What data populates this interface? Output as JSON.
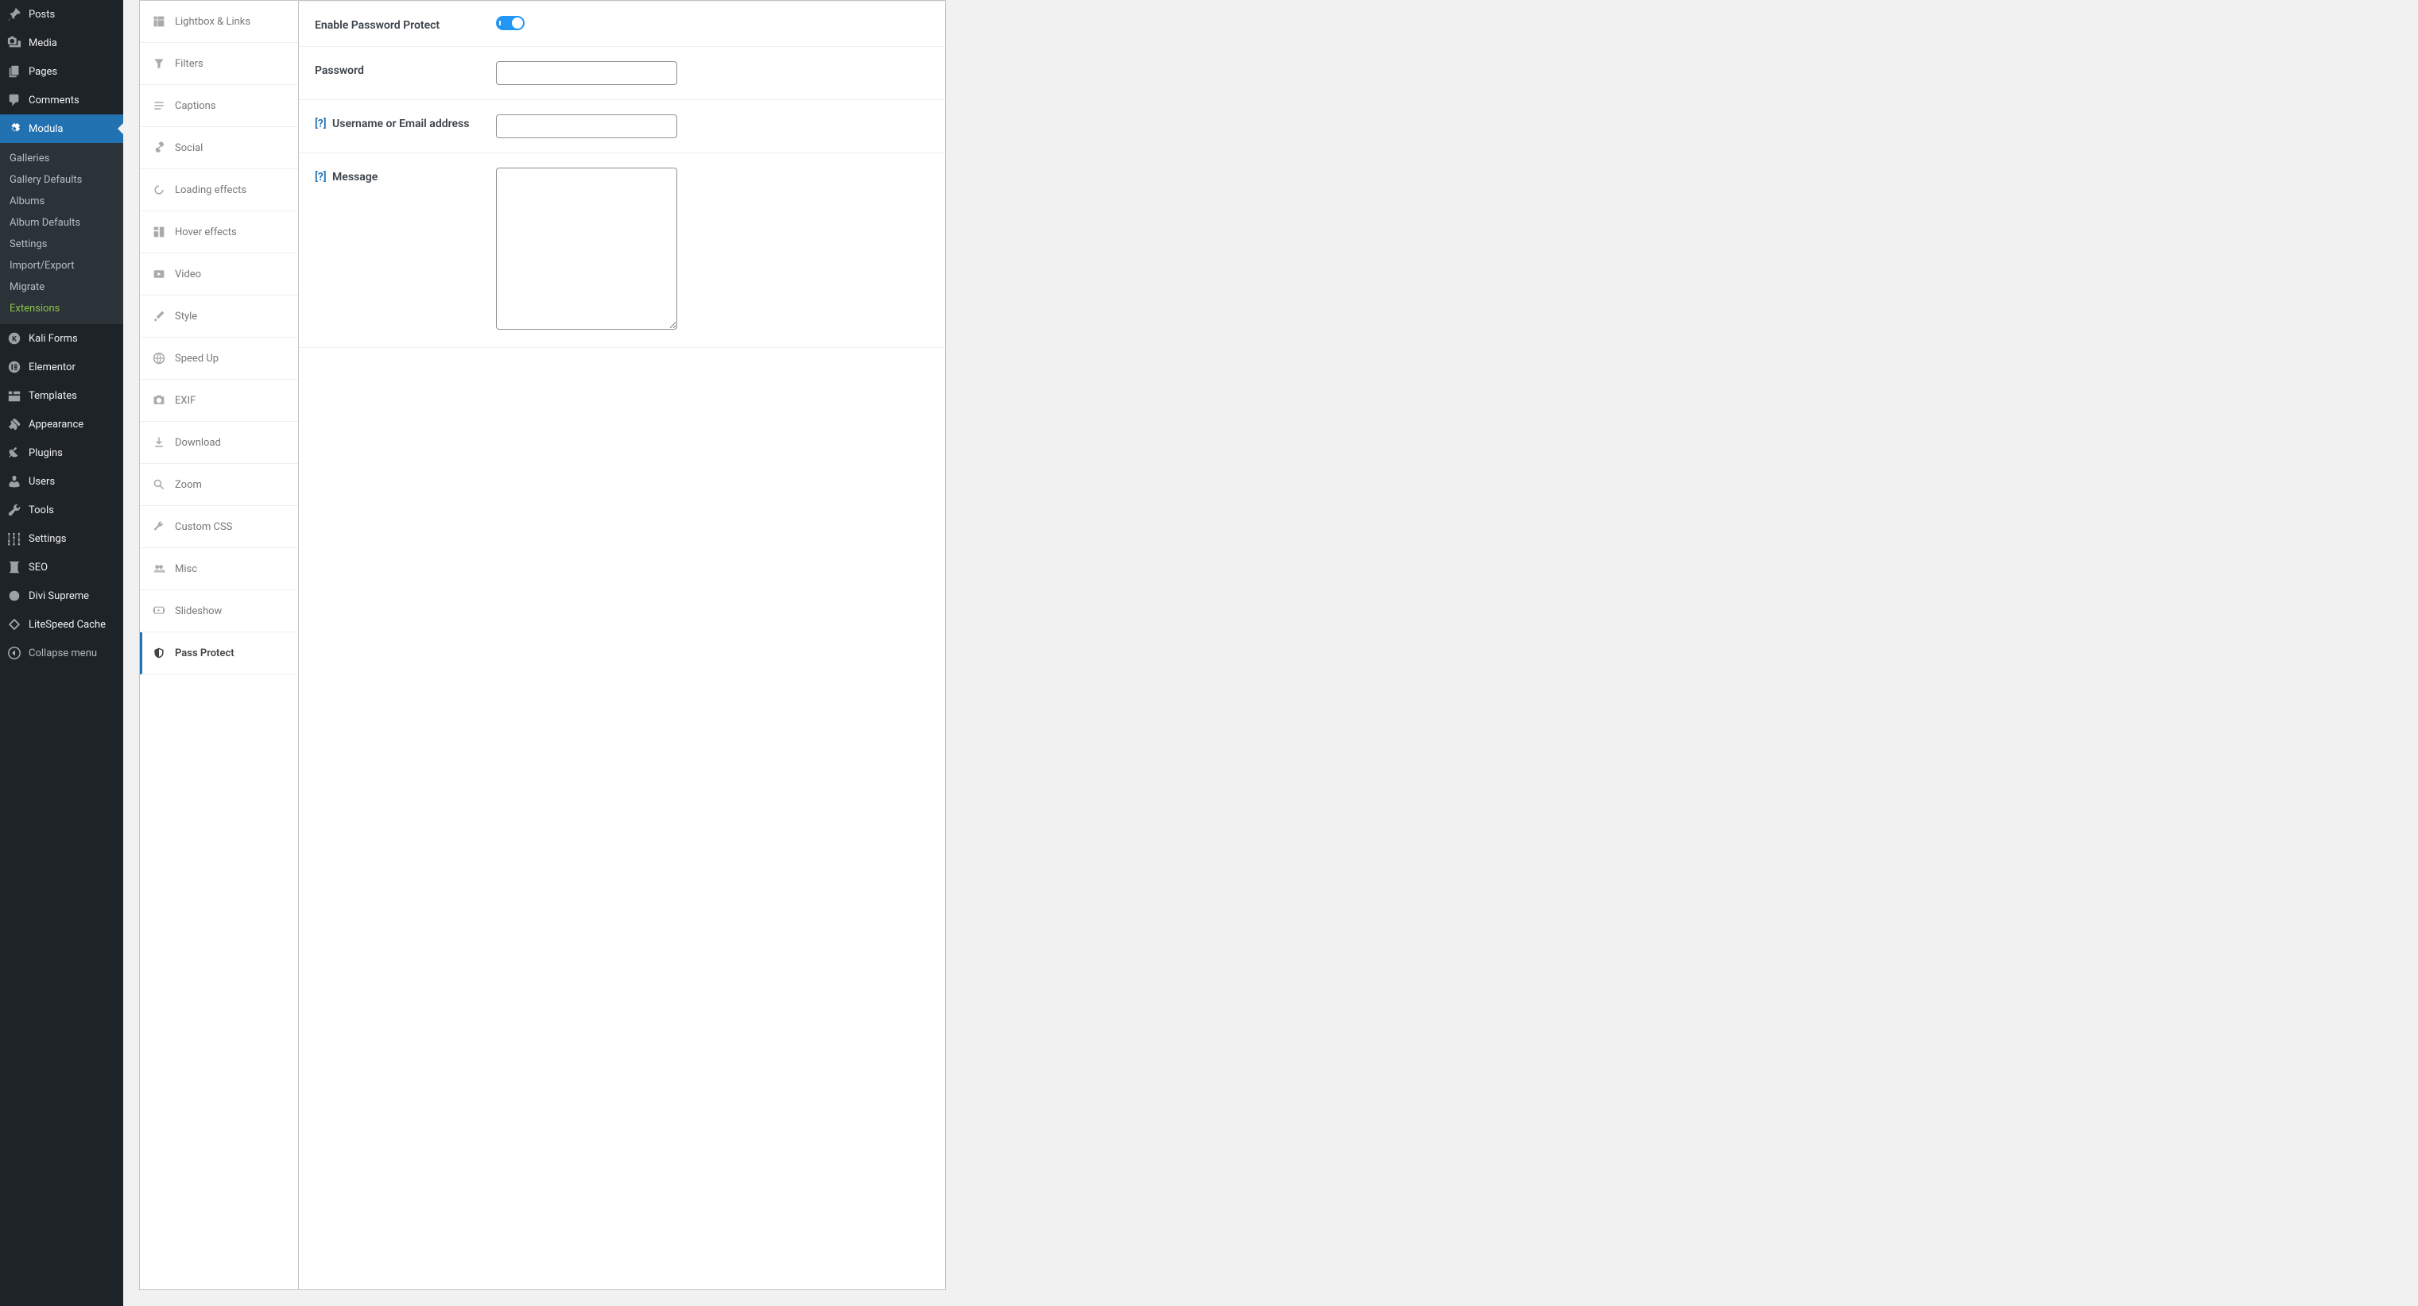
{
  "wp_menu": {
    "posts": "Posts",
    "media": "Media",
    "pages": "Pages",
    "comments": "Comments",
    "modula": "Modula",
    "kali_forms": "Kali Forms",
    "elementor": "Elementor",
    "templates": "Templates",
    "appearance": "Appearance",
    "plugins": "Plugins",
    "users": "Users",
    "tools": "Tools",
    "settings": "Settings",
    "seo": "SEO",
    "divi_supreme": "Divi Supreme",
    "litespeed": "LiteSpeed Cache",
    "collapse": "Collapse menu"
  },
  "modula_submenu": {
    "galleries": "Galleries",
    "gallery_defaults": "Gallery Defaults",
    "albums": "Albums",
    "album_defaults": "Album Defaults",
    "settings": "Settings",
    "import_export": "Import/Export",
    "migrate": "Migrate",
    "extensions": "Extensions"
  },
  "settings_tabs": {
    "lightbox_links": "Lightbox & Links",
    "filters": "Filters",
    "captions": "Captions",
    "social": "Social",
    "loading_effects": "Loading effects",
    "hover_effects": "Hover effects",
    "video": "Video",
    "style": "Style",
    "speed_up": "Speed Up",
    "exif": "EXIF",
    "download": "Download",
    "zoom": "Zoom",
    "custom_css": "Custom CSS",
    "misc": "Misc",
    "slideshow": "Slideshow",
    "pass_protect": "Pass Protect"
  },
  "form": {
    "enable_label": "Enable Password Protect",
    "enable_value": true,
    "password_label": "Password",
    "password_value": "",
    "username_label": "Username or Email address",
    "username_value": "",
    "message_label": "Message",
    "message_value": "",
    "help": "[?]"
  }
}
